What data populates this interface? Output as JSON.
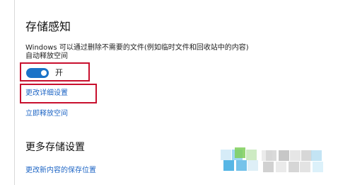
{
  "storage_sense": {
    "title": "存储感知",
    "description_line1": "Windows 可以通过删除不需要的文件(例如临时文件和回收站中的内容)",
    "description_line2": "自动释放空间",
    "toggle": {
      "state": "on",
      "label": "开"
    },
    "change_settings_link": "更改详细设置",
    "free_space_link": "立即释放空间"
  },
  "more_storage": {
    "title": "更多存储设置",
    "change_save_location_link": "更改新内容的保存位置"
  },
  "colors": {
    "accent": "#1a73c8",
    "link": "#1f66c5",
    "highlight_box": "#c8102e"
  }
}
